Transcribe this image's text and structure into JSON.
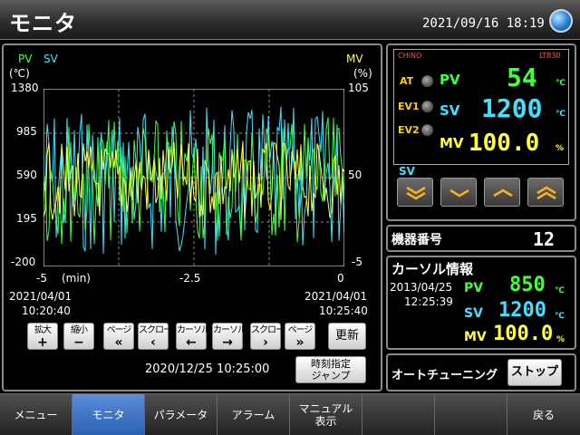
{
  "header": {
    "title": "モニタ",
    "datetime": "2021/09/16  18:19"
  },
  "trend": {
    "pv_label": "PV",
    "sv_label": "SV",
    "mv_label": "MV",
    "left_unit": "(℃)",
    "right_unit": "(%)",
    "left_ticks": [
      "1380",
      "985",
      "590",
      "195",
      "-200"
    ],
    "right_ticks": [
      "105",
      "50",
      "-5"
    ],
    "x_ticks": [
      "-5",
      "(min)",
      "-2.5",
      "0"
    ],
    "start_date": "2021/04/01",
    "start_time": "10:20:40",
    "end_date": "2021/04/01",
    "end_time": "10:25:40",
    "buttons": [
      {
        "label": "拡大",
        "symbol": "+"
      },
      {
        "label": "縮小",
        "symbol": "−"
      },
      {
        "label": "ページ",
        "symbol": "«"
      },
      {
        "label": "スクロール",
        "symbol": "‹"
      },
      {
        "label": "カーソル",
        "symbol": "←"
      },
      {
        "label": "カーソル",
        "symbol": "→"
      },
      {
        "label": "スクロール",
        "symbol": "›"
      },
      {
        "label": "ページ",
        "symbol": "»"
      }
    ],
    "update_label": "更新",
    "jump_datetime": "2020/12/25  10:25:00",
    "jump_label_1": "時刻指定",
    "jump_label_2": "ジャンプ",
    "colors": {
      "pv": "#40ff40",
      "sv": "#40e0ff",
      "mv": "#ffff40"
    }
  },
  "controller": {
    "brand": "CHINO",
    "model": "LT830",
    "at_label": "AT",
    "ev1_label": "EV1",
    "ev2_label": "EV2",
    "pv_label": "PV",
    "sv_label": "SV",
    "mv_label": "MV",
    "pv_value": "54",
    "sv_value": "1200",
    "mv_value": "100.0",
    "temp_unit": "℃",
    "pct_unit": "%",
    "sv_keys_label": "SV"
  },
  "device": {
    "label": "機器番号",
    "value": "12"
  },
  "cursor": {
    "title": "カーソル情報",
    "date": "2013/04/25",
    "time": "12:25:39",
    "pv_label": "PV",
    "pv_value": "850",
    "sv_label": "SV",
    "sv_value": "1200",
    "mv_label": "MV",
    "mv_value": "100.0",
    "temp_unit": "℃",
    "pct_unit": "%"
  },
  "autotune": {
    "label": "オートチューニング",
    "button": "ストップ"
  },
  "nav": {
    "items": [
      "メニュー",
      "モニタ",
      "パラメータ",
      "アラーム",
      "マニュアル",
      "",
      "",
      "戻る"
    ],
    "manual_line2": "表示"
  }
}
